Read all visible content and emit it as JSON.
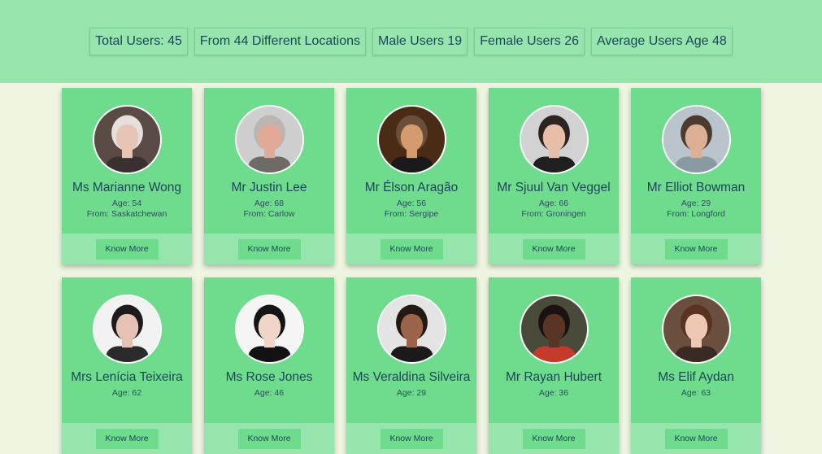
{
  "stats": [
    {
      "id": "total-users",
      "label": "Total Users: 45"
    },
    {
      "id": "locations",
      "label": "From 44 Different Locations"
    },
    {
      "id": "male-users",
      "label": "Male Users 19"
    },
    {
      "id": "female-users",
      "label": "Female Users 26"
    },
    {
      "id": "average-age",
      "label": "Average Users Age 48"
    }
  ],
  "button_label": "Know More",
  "users": [
    {
      "name": "Ms Marianne Wong",
      "age": "Age: 54",
      "from": "From: Saskatchewan",
      "photo": {
        "bg": "#5a4a44",
        "skin": "#e8c4b4",
        "hair": "#e6e0dc",
        "shirt": "#3b3030"
      }
    },
    {
      "name": "Mr Justin Lee",
      "age": "Age: 68",
      "from": "From: Carlow",
      "photo": {
        "bg": "#cfcfcf",
        "skin": "#e2a996",
        "hair": "#bdb5b0",
        "shirt": "#6e6a66"
      }
    },
    {
      "name": "Mr Élson Aragão",
      "age": "Age: 56",
      "from": "From: Sergipe",
      "photo": {
        "bg": "#4a2c16",
        "skin": "#d59a6d",
        "hair": "#6b4e37",
        "shirt": "#1a1a1a"
      }
    },
    {
      "name": "Mr Sjuul Van Veggel",
      "age": "Age: 66",
      "from": "From: Groningen",
      "photo": {
        "bg": "#d2d2d2",
        "skin": "#e7bfa8",
        "hair": "#2c2420",
        "shirt": "#1f1f1f"
      }
    },
    {
      "name": "Mr Elliot Bowman",
      "age": "Age: 29",
      "from": "From: Longford",
      "photo": {
        "bg": "#b9c4cc",
        "skin": "#ddb096",
        "hair": "#4a3a30",
        "shirt": "#8a9aa3"
      }
    },
    {
      "name": "Mrs Lenícia Teixeira",
      "age": "Age: 62",
      "from": "",
      "photo": {
        "bg": "#f2f2f2",
        "skin": "#e6c2b5",
        "hair": "#1e1a1c",
        "shirt": "#2a2a2a"
      }
    },
    {
      "name": "Ms Rose Jones",
      "age": "Age: 46",
      "from": "",
      "photo": {
        "bg": "#f5f5f5",
        "skin": "#f1d5c6",
        "hair": "#141414",
        "shirt": "#121212"
      }
    },
    {
      "name": "Ms Veraldina Silveira",
      "age": "Age: 29",
      "from": "",
      "photo": {
        "bg": "#e4e4e4",
        "skin": "#9a6448",
        "hair": "#241812",
        "shirt": "#1a1a1a"
      }
    },
    {
      "name": "Mr Rayan Hubert",
      "age": "Age: 36",
      "from": "",
      "photo": {
        "bg": "#4a4a3a",
        "skin": "#5a3424",
        "hair": "#1a1210",
        "shirt": "#c63a2c"
      }
    },
    {
      "name": "Ms Elif Aydan",
      "age": "Age: 63",
      "from": "",
      "photo": {
        "bg": "#6a4e3e",
        "skin": "#efc8b4",
        "hair": "#5a3222",
        "shirt": "#3a2a24"
      }
    }
  ]
}
